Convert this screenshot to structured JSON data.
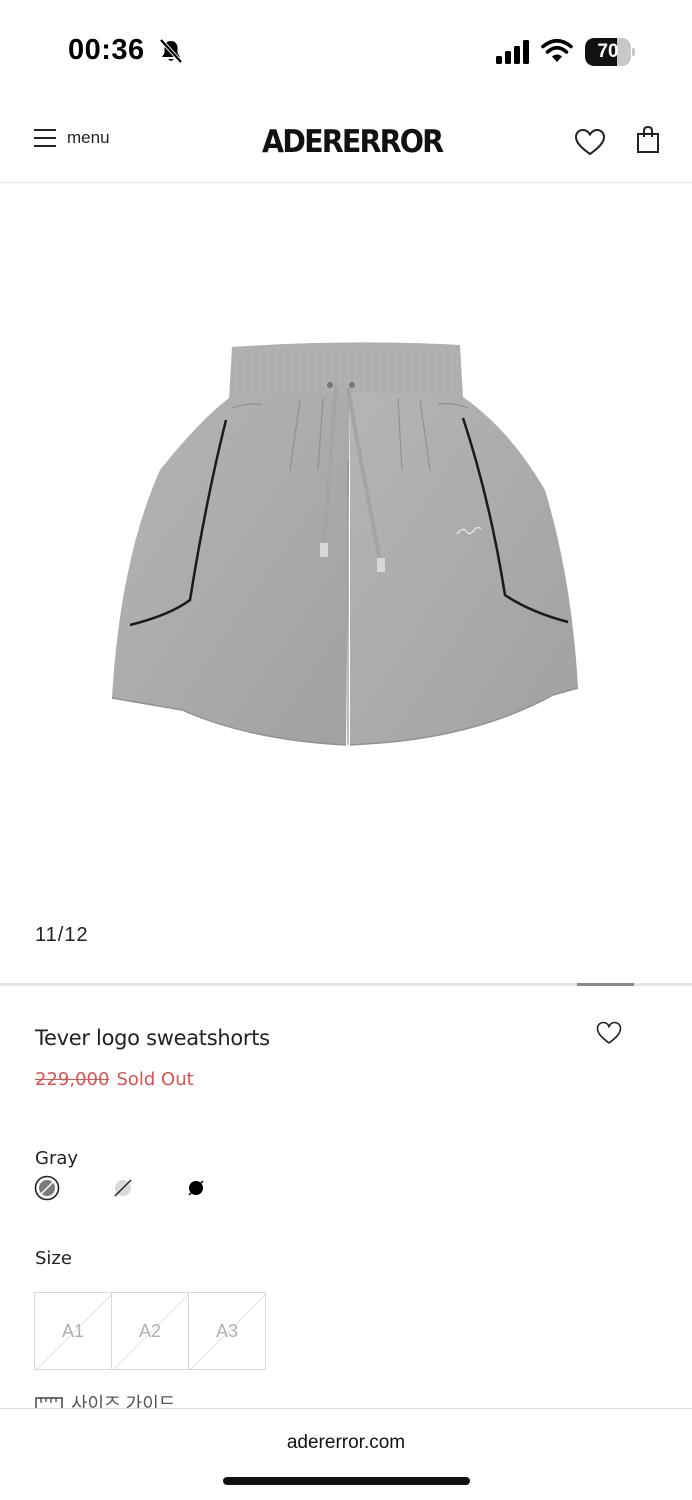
{
  "status_bar": {
    "time": "00:36",
    "battery": "70",
    "battery_level": 0.7
  },
  "header": {
    "menu_label": "menu",
    "logo": "ADERERROR"
  },
  "gallery": {
    "counter": "11/12",
    "current": 11,
    "total": 12
  },
  "product": {
    "title": "Tever logo sweatshorts",
    "original_price": "229,000",
    "status": "Sold Out",
    "color_name": "Gray",
    "size_label": "Size",
    "sizes": [
      "A1",
      "A2",
      "A3"
    ],
    "size_guide_label": "사이즈 가이드"
  },
  "colors": {
    "accent_red": "#d9534f",
    "gray_swatch": "#7a7a7a",
    "light_swatch": "#d9d9d9",
    "black_swatch": "#000000"
  },
  "browser": {
    "url": "adererror.com"
  }
}
